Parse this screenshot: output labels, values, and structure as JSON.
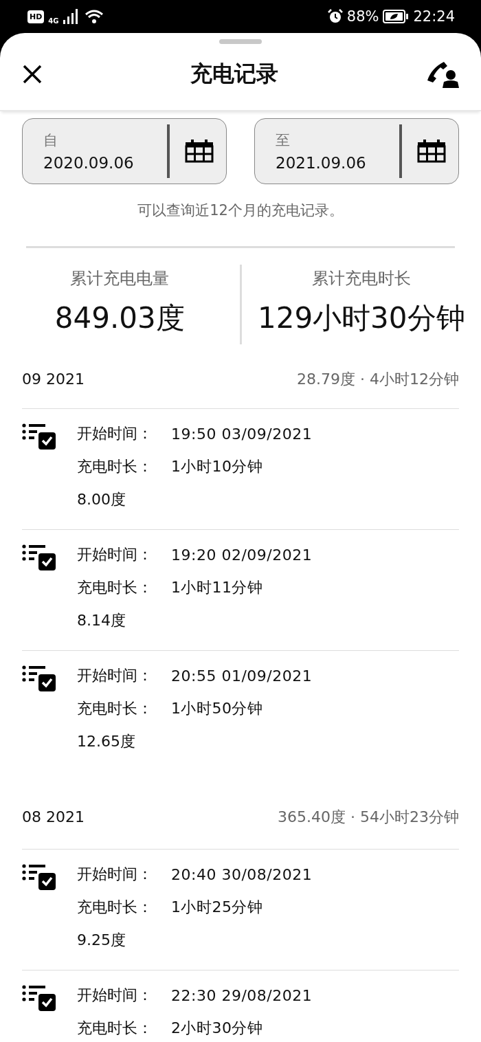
{
  "status_bar": {
    "hd": "HD",
    "network": "4G",
    "battery": "88%",
    "time": "22:24"
  },
  "header": {
    "title": "充电记录"
  },
  "date_range": [
    {
      "label": "自",
      "value": "2020.09.06"
    },
    {
      "label": "至",
      "value": "2021.09.06"
    }
  ],
  "note": "可以查询近12个月的充电记录。",
  "totals": [
    {
      "label": "累计充电电量",
      "value": "849.03度"
    },
    {
      "label": "累计充电时长",
      "value": "129小时30分钟"
    }
  ],
  "months": [
    {
      "title": "09 2021",
      "summary": "28.79度 · 4小时12分钟",
      "records": [
        {
          "start_label": "开始时间：",
          "start": "19:50 03/09/2021",
          "duration_label": "充电时长：",
          "duration": "1小时10分钟",
          "energy": "8.00度"
        },
        {
          "start_label": "开始时间：",
          "start": "19:20 02/09/2021",
          "duration_label": "充电时长：",
          "duration": "1小时11分钟",
          "energy": "8.14度"
        },
        {
          "start_label": "开始时间：",
          "start": "20:55 01/09/2021",
          "duration_label": "充电时长：",
          "duration": "1小时50分钟",
          "energy": "12.65度"
        }
      ]
    },
    {
      "title": "08 2021",
      "summary": "365.40度 · 54小时23分钟",
      "records": [
        {
          "start_label": "开始时间：",
          "start": "20:40 30/08/2021",
          "duration_label": "充电时长：",
          "duration": "1小时25分钟",
          "energy": "9.25度"
        },
        {
          "start_label": "开始时间：",
          "start": "22:30 29/08/2021",
          "duration_label": "充电时长：",
          "duration": "2小时30分钟"
        }
      ]
    }
  ]
}
